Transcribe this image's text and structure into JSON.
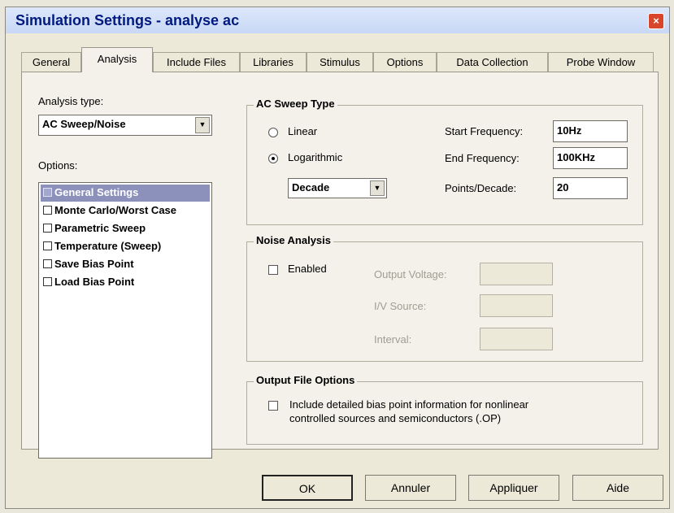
{
  "window": {
    "title": "Simulation Settings - analyse ac",
    "close_glyph": "×"
  },
  "tabs": [
    {
      "label": "General"
    },
    {
      "label": "Analysis"
    },
    {
      "label": "Include Files"
    },
    {
      "label": "Libraries"
    },
    {
      "label": "Stimulus"
    },
    {
      "label": "Options"
    },
    {
      "label": "Data Collection"
    },
    {
      "label": "Probe Window"
    }
  ],
  "analysis_type": {
    "label": "Analysis type:",
    "value": "AC Sweep/Noise"
  },
  "options": {
    "label": "Options:",
    "items": [
      {
        "label": "General Settings",
        "checked": true,
        "selected": true
      },
      {
        "label": "Monte Carlo/Worst Case",
        "checked": false
      },
      {
        "label": "Parametric Sweep",
        "checked": false
      },
      {
        "label": "Temperature (Sweep)",
        "checked": false
      },
      {
        "label": "Save Bias Point",
        "checked": false
      },
      {
        "label": "Load Bias Point",
        "checked": false
      }
    ]
  },
  "ac_sweep": {
    "title": "AC Sweep Type",
    "linear": "Linear",
    "logarithmic": "Logarithmic",
    "selected": "Logarithmic",
    "log_mode": "Decade",
    "start_label": "Start Frequency:",
    "start_value": "10Hz",
    "end_label": "End Frequency:",
    "end_value": "100KHz",
    "points_label": "Points/Decade:",
    "points_value": "20"
  },
  "noise": {
    "title": "Noise Analysis",
    "enabled_label": "Enabled",
    "enabled": false,
    "output_voltage": "Output Voltage:",
    "iv_source": "I/V Source:",
    "interval": "Interval:"
  },
  "output_file": {
    "title": "Output File Options",
    "line1": "Include detailed bias point information for nonlinear",
    "line2": "controlled sources and semiconductors (.OP)"
  },
  "buttons": {
    "ok": "OK",
    "cancel": "Annuler",
    "apply": "Appliquer",
    "help": "Aide"
  }
}
